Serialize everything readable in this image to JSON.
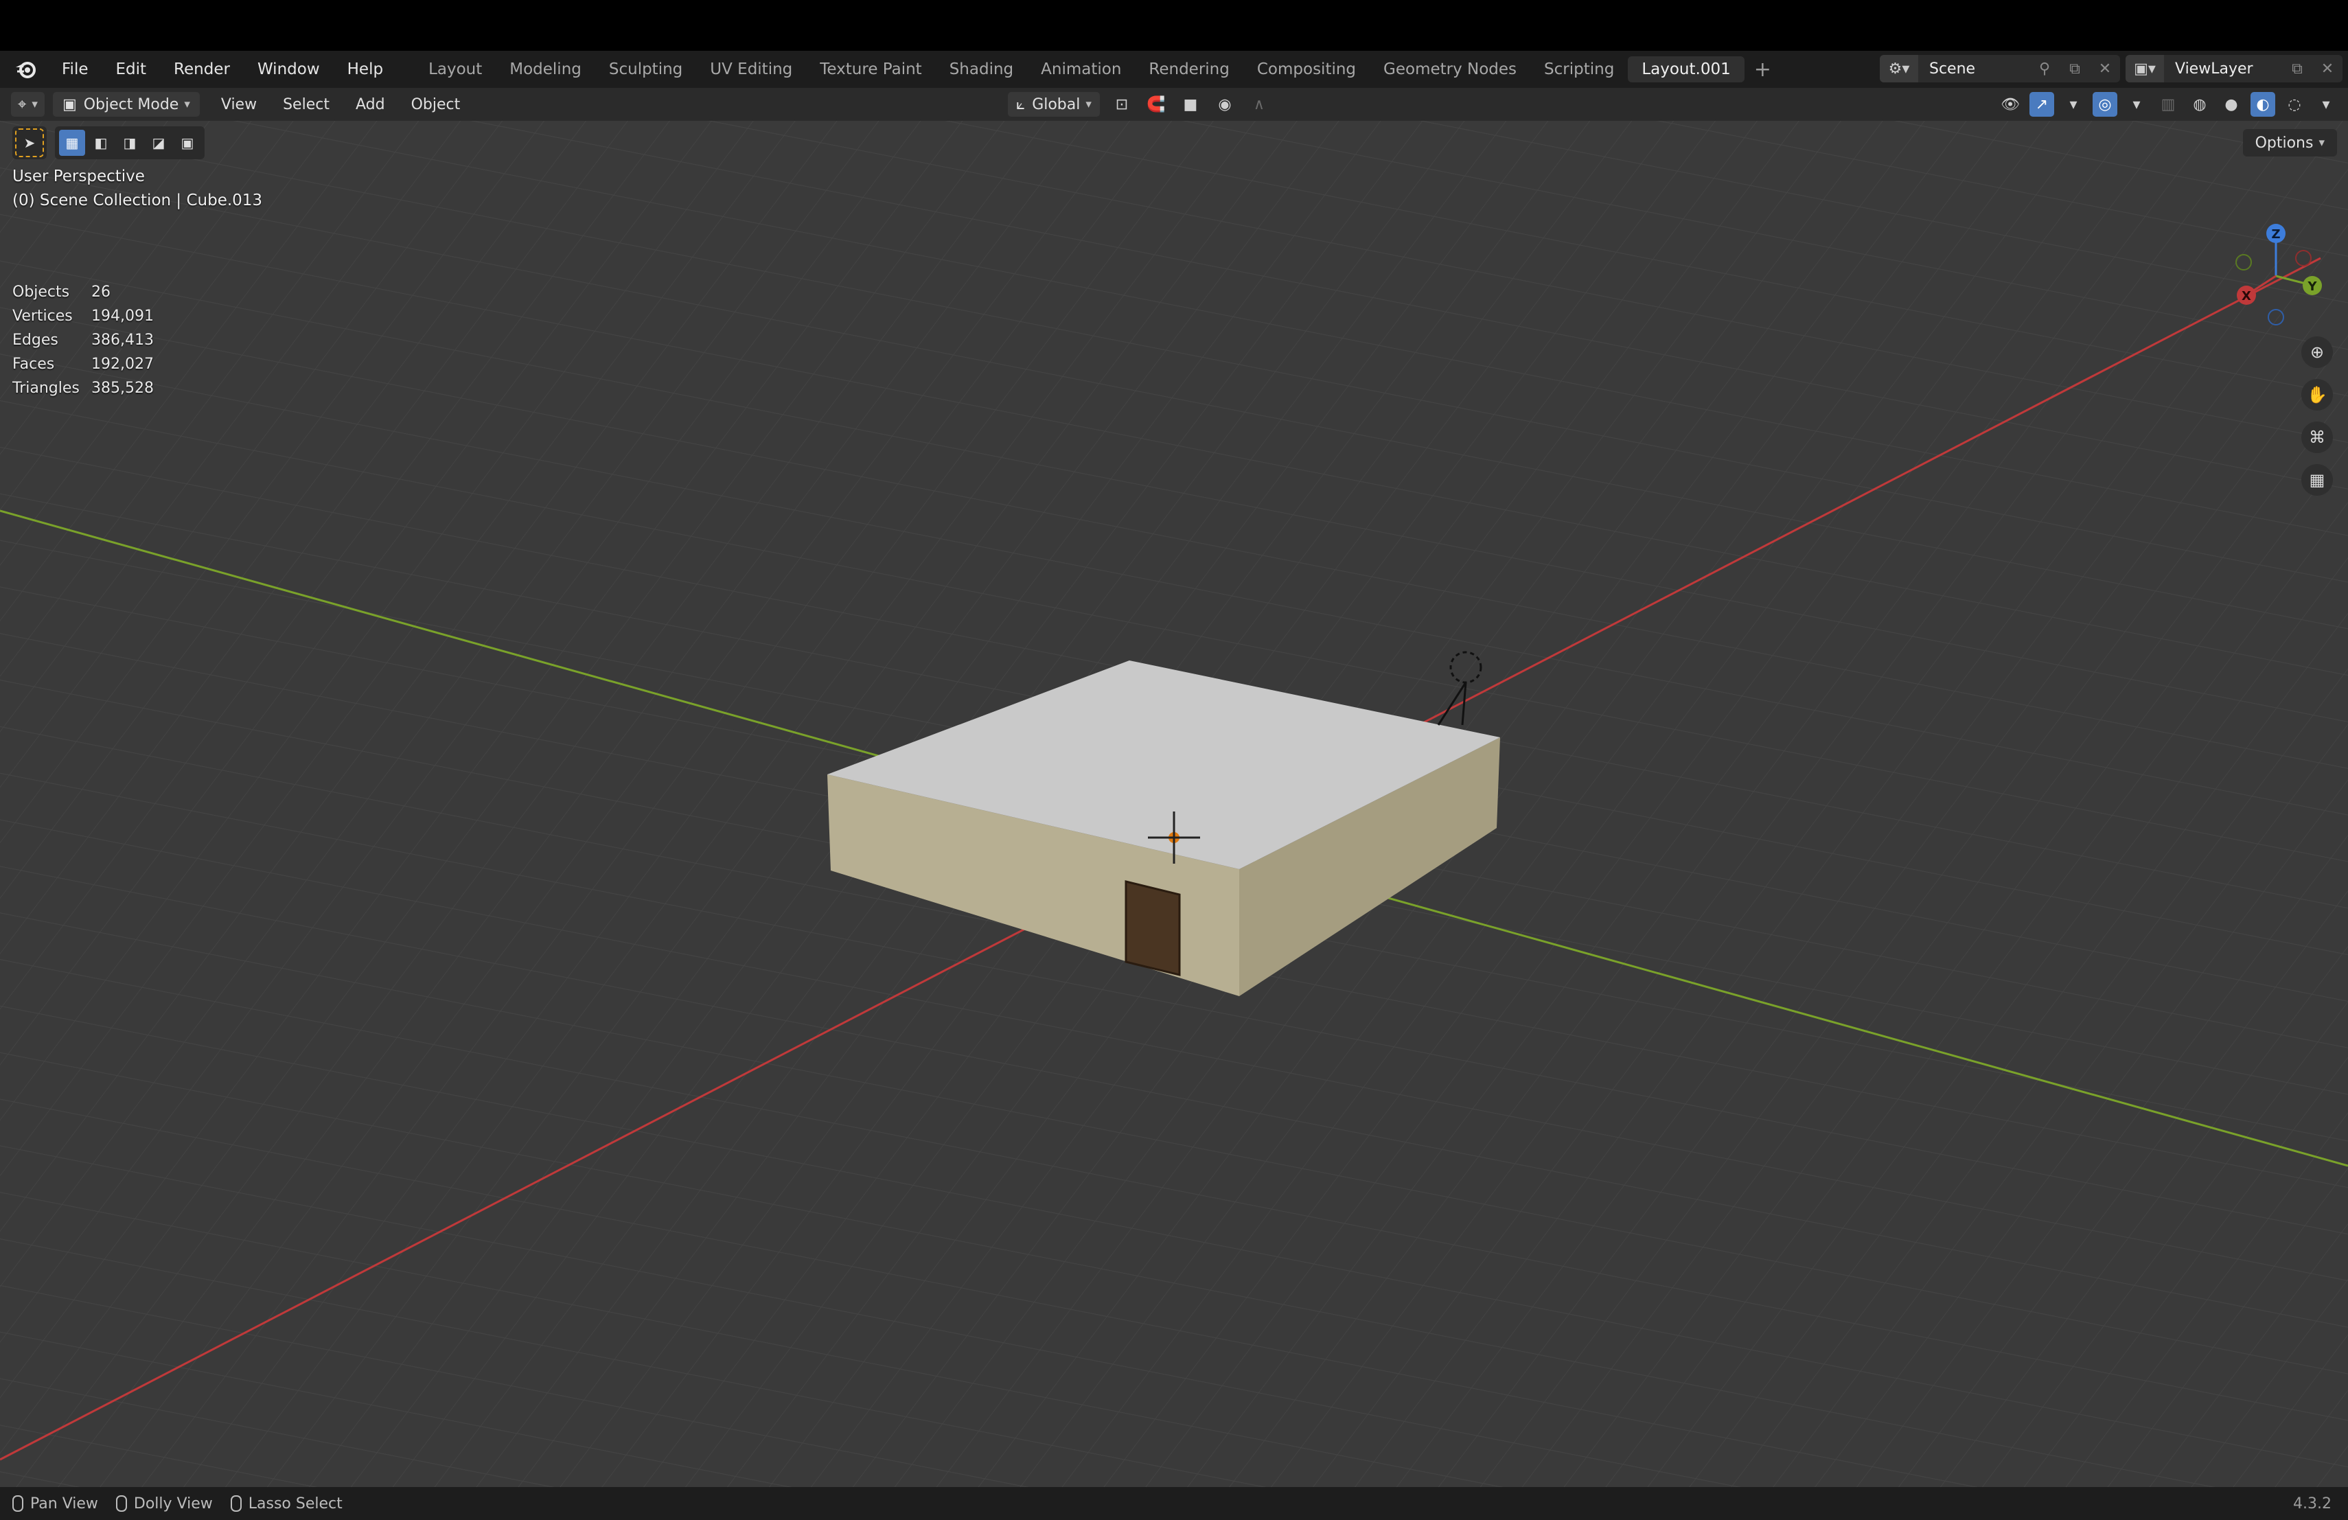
{
  "menus": [
    "File",
    "Edit",
    "Render",
    "Window",
    "Help"
  ],
  "workspace_tabs": [
    {
      "label": "Layout"
    },
    {
      "label": "Modeling"
    },
    {
      "label": "Sculpting"
    },
    {
      "label": "UV Editing"
    },
    {
      "label": "Texture Paint"
    },
    {
      "label": "Shading"
    },
    {
      "label": "Animation"
    },
    {
      "label": "Rendering"
    },
    {
      "label": "Compositing"
    },
    {
      "label": "Geometry Nodes"
    },
    {
      "label": "Scripting"
    },
    {
      "label": "Layout.001",
      "active": true
    }
  ],
  "scene": {
    "name": "Scene"
  },
  "view_layer": {
    "name": "ViewLayer"
  },
  "header": {
    "mode": "Object Mode",
    "menus": [
      "View",
      "Select",
      "Add",
      "Object"
    ],
    "transform_orientation": "Global"
  },
  "viewport": {
    "options_label": "Options",
    "perspective": "User Perspective",
    "collection_line": "(0) Scene Collection | Cube.013",
    "stats": [
      {
        "label": "Objects",
        "value": "26"
      },
      {
        "label": "Vertices",
        "value": "194,091"
      },
      {
        "label": "Edges",
        "value": "386,413"
      },
      {
        "label": "Faces",
        "value": "192,027"
      },
      {
        "label": "Triangles",
        "value": "385,528"
      }
    ],
    "gizmo_axes": {
      "z": "Z",
      "y": "Y",
      "x": "X"
    }
  },
  "statusbar": {
    "items": [
      "Pan View",
      "Dolly View",
      "Lasso Select"
    ],
    "version": "4.3.2"
  },
  "colors": {
    "x_axis": "#c0393a",
    "y_axis": "#7aa22a",
    "z_axis": "#3d7ddb",
    "accent": "#4a7bbf",
    "grid_bg": "#3a3a3a"
  }
}
